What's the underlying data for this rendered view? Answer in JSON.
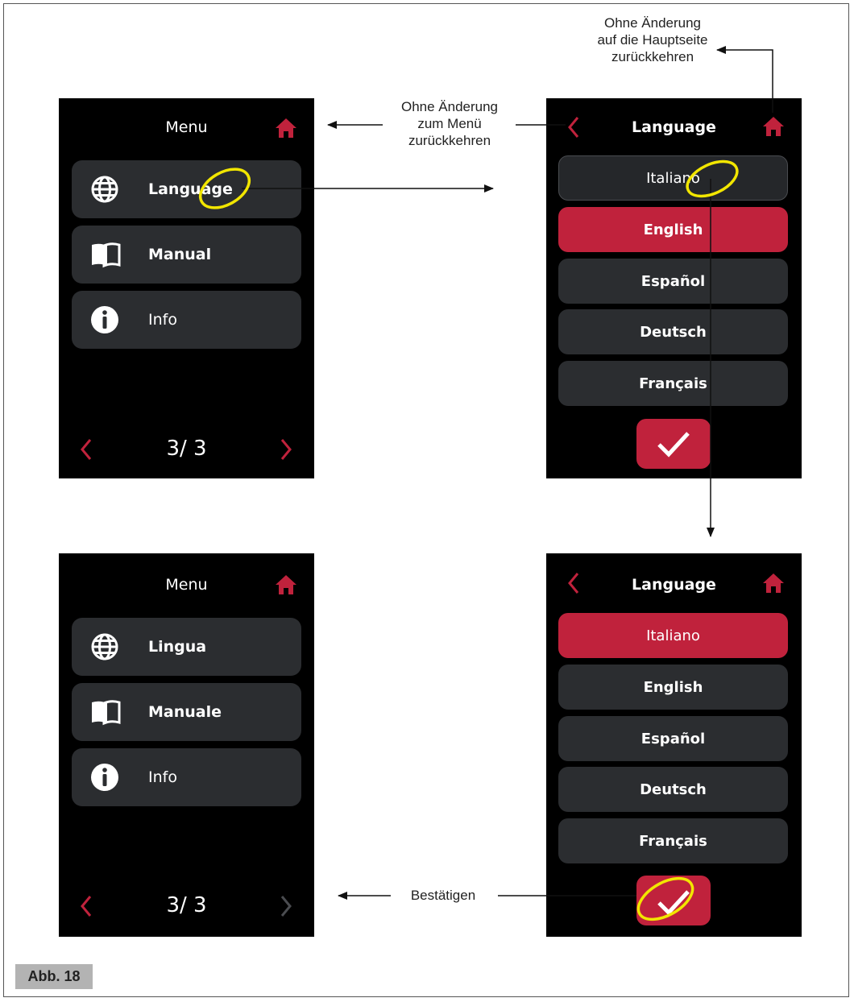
{
  "annotations": {
    "home_return": [
      "Ohne Änderung",
      "auf die Hauptseite",
      "zurückkehren"
    ],
    "menu_return": [
      "Ohne Änderung",
      "zum Menü",
      "zurückkehren"
    ],
    "confirm": "Bestätigen"
  },
  "figure_label": "Abb. 18",
  "screen_menu_top": {
    "title": "Menu",
    "items": [
      {
        "label": "Language",
        "icon": "globe-icon"
      },
      {
        "label": "Manual",
        "icon": "book-icon"
      },
      {
        "label": "Info",
        "icon": "info-icon"
      }
    ],
    "pager": "3/ 3"
  },
  "screen_language_top": {
    "title": "Language",
    "options": [
      "Italiano",
      "English",
      "Español",
      "Deutsch",
      "Français"
    ],
    "selected": "English"
  },
  "screen_menu_bottom": {
    "title": "Menu",
    "items": [
      {
        "label": "Lingua",
        "icon": "globe-icon"
      },
      {
        "label": "Manuale",
        "icon": "book-icon"
      },
      {
        "label": "Info",
        "icon": "info-icon"
      }
    ],
    "pager": "3/ 3"
  },
  "screen_language_bottom": {
    "title": "Language",
    "options": [
      "Italiano",
      "English",
      "Español",
      "Deutsch",
      "Français"
    ],
    "selected": "Italiano"
  },
  "colors": {
    "accent": "#c0223c",
    "screen_bg": "#000000",
    "item_bg": "#2b2d30",
    "highlight": "#f2e600"
  }
}
